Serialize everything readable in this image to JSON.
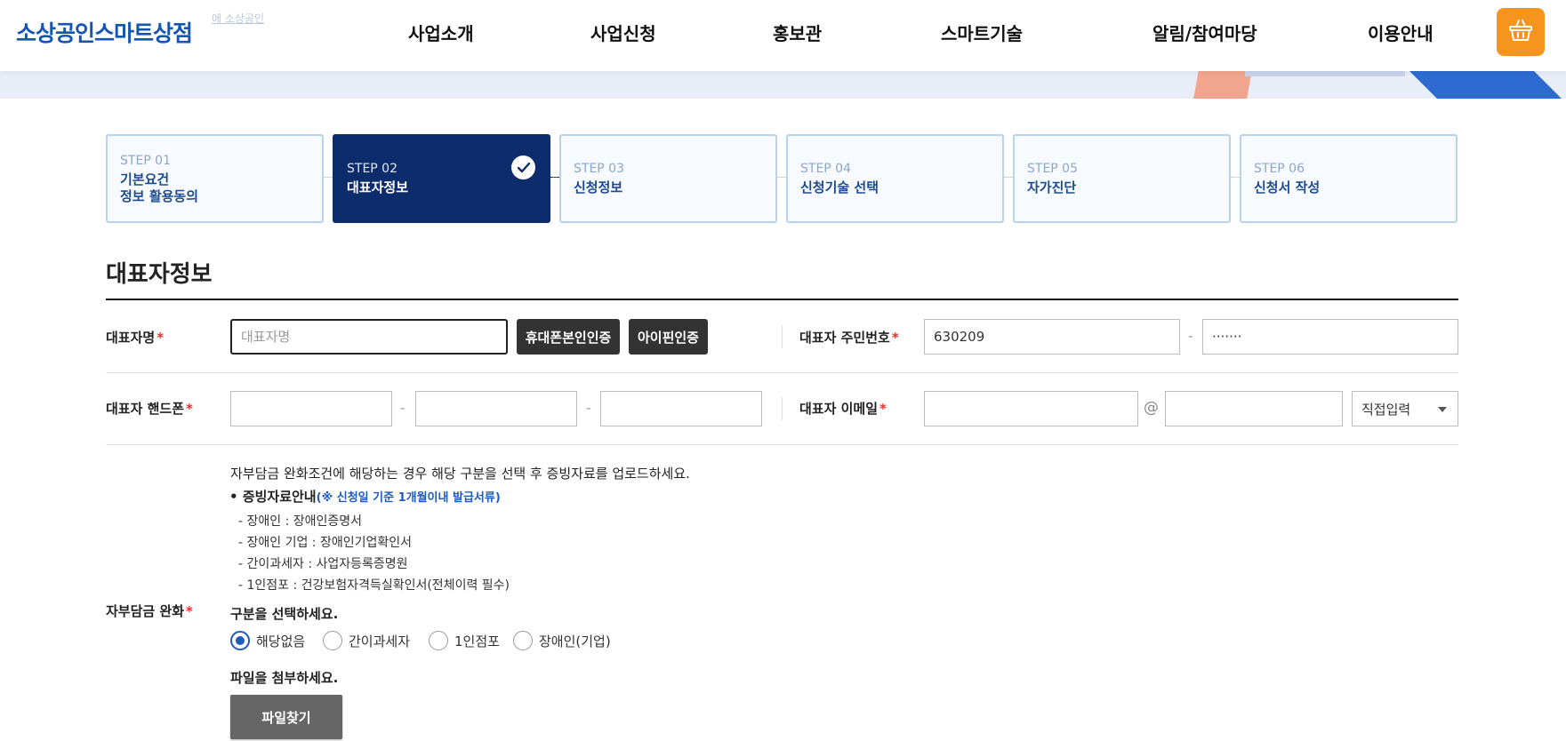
{
  "header": {
    "logo": "소상공인스마트상점",
    "logo_sub": "에 소상공인",
    "nav": [
      "사업소개",
      "사업신청",
      "홍보관",
      "스마트기술",
      "알림/참여마당",
      "이용안내"
    ],
    "cart_icon": "basket-icon"
  },
  "steps": [
    {
      "num": "STEP 01",
      "title": "기본요건\n정보 활용동의",
      "active": false
    },
    {
      "num": "STEP 02",
      "title": "대표자정보",
      "active": true
    },
    {
      "num": "STEP 03",
      "title": "신청정보",
      "active": false
    },
    {
      "num": "STEP 04",
      "title": "신청기술 선택",
      "active": false
    },
    {
      "num": "STEP 05",
      "title": "자가진단",
      "active": false
    },
    {
      "num": "STEP 06",
      "title": "신청서 작성",
      "active": false
    }
  ],
  "section": {
    "title": "대표자정보"
  },
  "form": {
    "name_label": "대표자명",
    "name_placeholder": "대표자명",
    "phone_auth_btn": "휴대폰본인인증",
    "ipin_btn": "아이핀인증",
    "rrn_label": "대표자 주민번호",
    "rrn_first": "630209",
    "rrn_second": "·······",
    "mobile_label": "대표자 핸드폰",
    "email_label": "대표자 이메일",
    "email_domain_select": "직접입력",
    "dash": "-",
    "at": "@",
    "required_mark": "*",
    "relief_label": "자부담금 완화",
    "relief_intro": "자부담금 완화조건에 해당하는 경우 해당 구분을 선택 후 증빙자료를 업로드하세요.",
    "evidence_bullet": "• 증빙자료안내",
    "evidence_note": "(※ 신청일 기준 1개월이내 발급서류)",
    "evidence_items": [
      "- 장애인 : 장애인증명서",
      "- 장애인 기업 : 장애인기업확인서",
      "- 간이과세자 : 사업자등록증명원",
      "- 1인점포 : 건강보험자격득실확인서(전체이력 필수)"
    ],
    "select_heading": "구분을 선택하세요.",
    "radio_options": [
      "해당없음",
      "간이과세자",
      "1인점포",
      "장애인(기업)"
    ],
    "radio_selected": "해당없음",
    "file_heading": "파일을 첨부하세요.",
    "file_btn": "파일찾기"
  }
}
